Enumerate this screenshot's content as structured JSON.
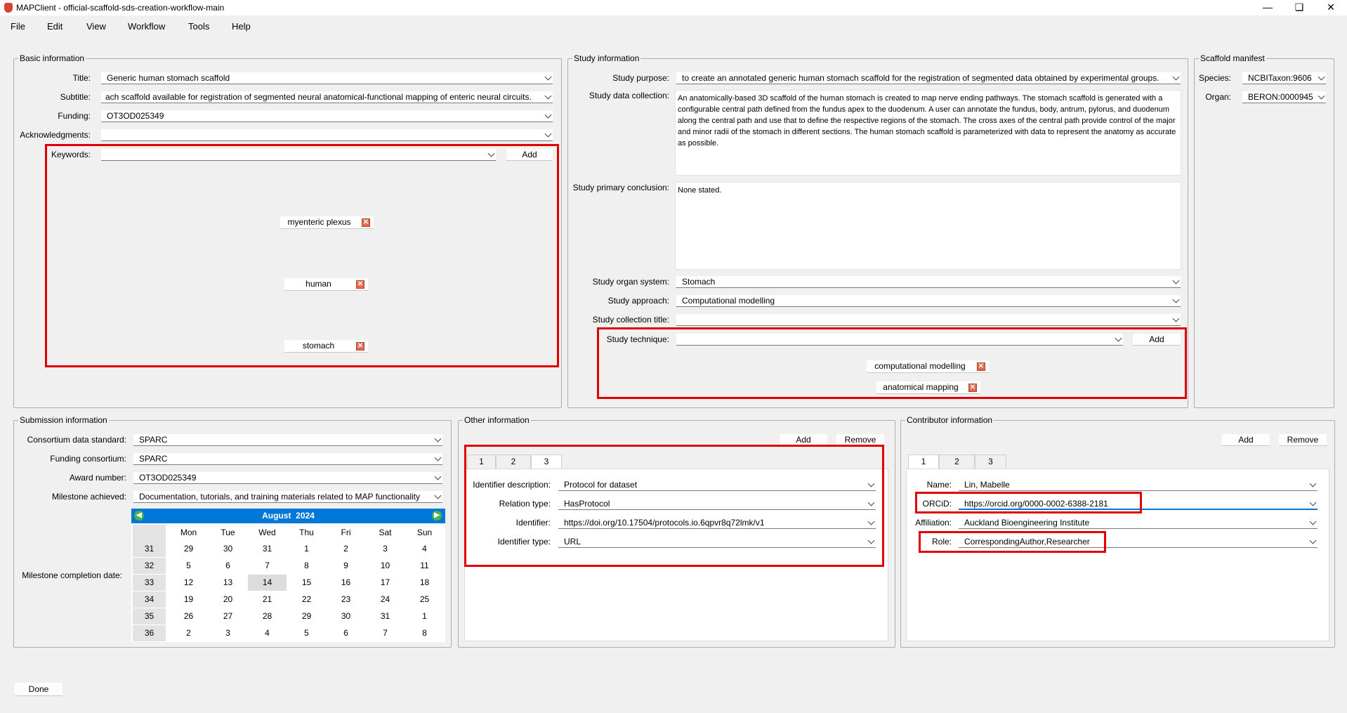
{
  "window": {
    "title": "MAPClient - official-scaffold-sds-creation-workflow-main"
  },
  "menu": [
    "File",
    "Edit",
    "View",
    "Workflow",
    "Tools",
    "Help"
  ],
  "basic": {
    "group_title": "Basic information",
    "title_label": "Title:",
    "title_value": "Generic human stomach scaffold",
    "subtitle_label": "Subtitle:",
    "subtitle_value": "ach scaffold available for registration of segmented neural anatomical-functional mapping of enteric neural circuits.",
    "funding_label": "Funding:",
    "funding_value": "OT3OD025349",
    "ack_label": "Acknowledgments:",
    "ack_value": "",
    "keywords_label": "Keywords:",
    "keywords_value": "",
    "add_label": "Add",
    "keywords": [
      "myenteric plexus",
      "human",
      "stomach"
    ]
  },
  "study": {
    "group_title": "Study information",
    "purpose_label": "Study purpose:",
    "purpose_value": "to create an annotated generic human stomach scaffold for the registration of segmented data obtained by experimental groups.",
    "collection_label": "Study data collection:",
    "collection_text": "An anatomically-based 3D scaffold of the human stomach is created to map nerve ending pathways. The stomach scaffold is generated with a configurable central path defined from the fundus apex to the duodenum. A user can annotate the fundus, body, antrum, pylorus, and duodenum along the central path and use that to define the respective regions of the stomach. The cross axes of the central path provide control of the major and minor radii of the stomach in different sections. The human stomach scaffold is parameterized with data to represent the anatomy as accurate as possible.",
    "conclusion_label": "Study primary conclusion:",
    "conclusion_text": "None stated.",
    "organ_label": "Study organ system:",
    "organ_value": "Stomach",
    "approach_label": "Study approach:",
    "approach_value": "Computational modelling",
    "coll_title_label": "Study collection title:",
    "coll_title_value": "",
    "technique_label": "Study technique:",
    "technique_value": "",
    "add_label": "Add",
    "techniques": [
      "computational modelling",
      "anatomical mapping"
    ]
  },
  "manifest": {
    "group_title": "Scaffold manifest",
    "species_label": "Species:",
    "species_value": "NCBITaxon:9606",
    "organ_label": "Organ:",
    "organ_value": "BERON:0000945"
  },
  "submission": {
    "group_title": "Submission information",
    "consortium_label": "Consortium data standard:",
    "consortium_value": "SPARC",
    "funding_label": "Funding consortium:",
    "funding_value": "SPARC",
    "award_label": "Award number:",
    "award_value": "OT3OD025349",
    "milestone_label": "Milestone achieved:",
    "milestone_value": "Documentation, tutorials, and training materials related to MAP functionality",
    "date_label": "Milestone completion date:",
    "calendar": {
      "month": "August",
      "year": "2024",
      "days": [
        "Mon",
        "Tue",
        "Wed",
        "Thu",
        "Fri",
        "Sat",
        "Sun"
      ],
      "weeks": [
        {
          "wk": "31",
          "d": [
            "29",
            "30",
            "31",
            "1",
            "2",
            "3",
            "4"
          ]
        },
        {
          "wk": "32",
          "d": [
            "5",
            "6",
            "7",
            "8",
            "9",
            "10",
            "11"
          ]
        },
        {
          "wk": "33",
          "d": [
            "12",
            "13",
            "14",
            "15",
            "16",
            "17",
            "18"
          ]
        },
        {
          "wk": "34",
          "d": [
            "19",
            "20",
            "21",
            "22",
            "23",
            "24",
            "25"
          ]
        },
        {
          "wk": "35",
          "d": [
            "26",
            "27",
            "28",
            "29",
            "30",
            "31",
            "1"
          ]
        },
        {
          "wk": "36",
          "d": [
            "2",
            "3",
            "4",
            "5",
            "6",
            "7",
            "8"
          ]
        }
      ]
    }
  },
  "other": {
    "group_title": "Other information",
    "add_label": "Add",
    "remove_label": "Remove",
    "tabs": [
      "1",
      "2",
      "3"
    ],
    "id_desc_label": "Identifier description:",
    "id_desc_value": "Protocol for dataset",
    "relation_label": "Relation type:",
    "relation_value": "HasProtocol",
    "identifier_label": "Identifier:",
    "identifier_value": "https://doi.org/10.17504/protocols.io.6qpvr8q72lmk/v1",
    "id_type_label": "Identifier type:",
    "id_type_value": "URL"
  },
  "contributor": {
    "group_title": "Contributor information",
    "add_label": "Add",
    "remove_label": "Remove",
    "tabs": [
      "1",
      "2",
      "3"
    ],
    "name_label": "Name:",
    "name_value": "Lin, Mabelle",
    "orcid_label": "ORCiD:",
    "orcid_value": "https://orcid.org/0000-0002-6388-2181",
    "affiliation_label": "Affiliation:",
    "affiliation_value": "Auckland Bioengineering Institute",
    "role_label": "Role:",
    "role_value": "CorrespondingAuthor,Researcher"
  },
  "done_label": "Done"
}
